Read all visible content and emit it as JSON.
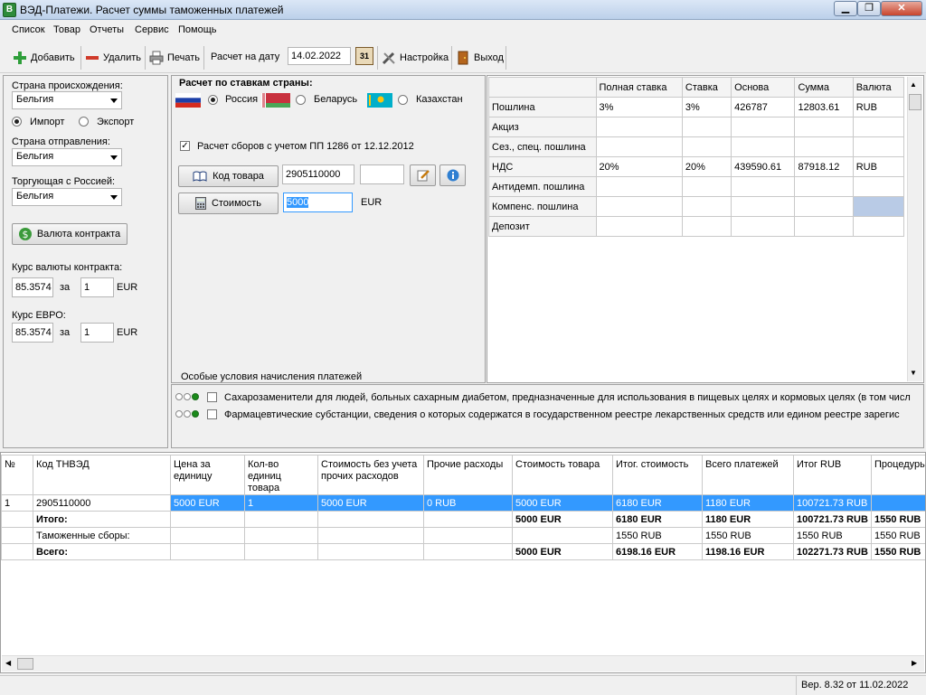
{
  "window": {
    "title": "ВЭД-Платежи. Расчет суммы таможенных платежей",
    "icon_letter": "В"
  },
  "menu": [
    "Список",
    "Товар",
    "Отчеты",
    "Сервис",
    "Помощь"
  ],
  "toolbar": {
    "add": "Добавить",
    "delete": "Удалить",
    "print": "Печать",
    "date_label": "Расчет на дату",
    "date_value": "14.02.2022",
    "calendar_icon_text": "31",
    "settings": "Настройка",
    "exit": "Выход"
  },
  "left": {
    "origin_label": "Страна происхождения:",
    "origin_value": "Бельгия",
    "import_label": "Импорт",
    "export_label": "Экспорт",
    "departure_label": "Страна отправления:",
    "departure_value": "Бельгия",
    "trading_label": "Торгующая с Россией:",
    "trading_value": "Бельгия",
    "currency_button": "Валюта контракта",
    "rate_label": "Курс валюты контракта:",
    "rate_value": "85.3574",
    "rate_for": "за",
    "rate_qty": "1",
    "rate_cur": "EUR",
    "euro_label": "Курс ЕВРО:",
    "euro_value": "85.3574",
    "euro_for": "за",
    "euro_qty": "1",
    "euro_cur": "EUR"
  },
  "middle": {
    "heading": "Расчет по ставкам страны:",
    "countries": [
      "Россия",
      "Беларусь",
      "Казахстан"
    ],
    "fees_check": "Расчет сборов с учетом ПП 1286 от 12.12.2012",
    "code_button": "Код товара",
    "code_value": "2905110000",
    "cost_button": "Стоимость",
    "cost_value": "5000",
    "cost_currency": "EUR",
    "special_label": "Особые условия начисления платежей"
  },
  "rates_table": {
    "headers": [
      "",
      "Полная ставка",
      "Ставка",
      "Основа",
      "Сумма",
      "Валюта"
    ],
    "rows": [
      [
        "Пошлина",
        "3%",
        "3%",
        "426787",
        "12803.61",
        "RUB"
      ],
      [
        "Акциз",
        "",
        "",
        "",
        "",
        ""
      ],
      [
        "Сез., спец. пошлина",
        "",
        "",
        "",
        "",
        ""
      ],
      [
        "НДС",
        "20%",
        "20%",
        "439590.61",
        "87918.12",
        "RUB"
      ],
      [
        "Антидемп. пошлина",
        "",
        "",
        "",
        "",
        ""
      ],
      [
        "Компенс. пошлина",
        "",
        "",
        "",
        "",
        ""
      ],
      [
        "Депозит",
        "",
        "",
        "",
        "",
        ""
      ]
    ]
  },
  "conditions": [
    "Сахарозаменители для людей, больных сахарным диабетом, предназначенные для использования в пищевых целях и кормовых целях (в том числ",
    "Фармацевтические субстанции, сведения о которых содержатся в государственном реестре лекарственных средств или едином реестре зарегис"
  ],
  "goods_table": {
    "headers": [
      "№",
      "Код ТНВЭД",
      "Цена за единицу",
      "Кол-во единиц товара",
      "Стоимость без учета прочих расходов",
      "Прочие расходы",
      "Стоимость товара",
      "Итог. стоимость",
      "Всего платежей",
      "Итог RUB",
      "Процедуры"
    ],
    "rows": [
      [
        "1",
        "2905110000",
        "5000 EUR",
        "1",
        "5000 EUR",
        "0 RUB",
        "5000 EUR",
        "6180 EUR",
        "1180 EUR",
        "100721.73 RUB",
        ""
      ],
      [
        "",
        "Итого:",
        "",
        "",
        "",
        "",
        "5000 EUR",
        "6180 EUR",
        "1180 EUR",
        "100721.73 RUB",
        "1550 RUB"
      ],
      [
        "",
        "Таможенные сборы:",
        "",
        "",
        "",
        "",
        "",
        "1550 RUB",
        "1550 RUB",
        "1550 RUB",
        "1550 RUB"
      ],
      [
        "",
        "Всего:",
        "",
        "",
        "",
        "",
        "5000 EUR",
        "6198.16 EUR",
        "1198.16 EUR",
        "102271.73 RUB",
        "1550 RUB"
      ]
    ]
  },
  "status": {
    "version": "Вер. 8.32 от 11.02.2022"
  }
}
